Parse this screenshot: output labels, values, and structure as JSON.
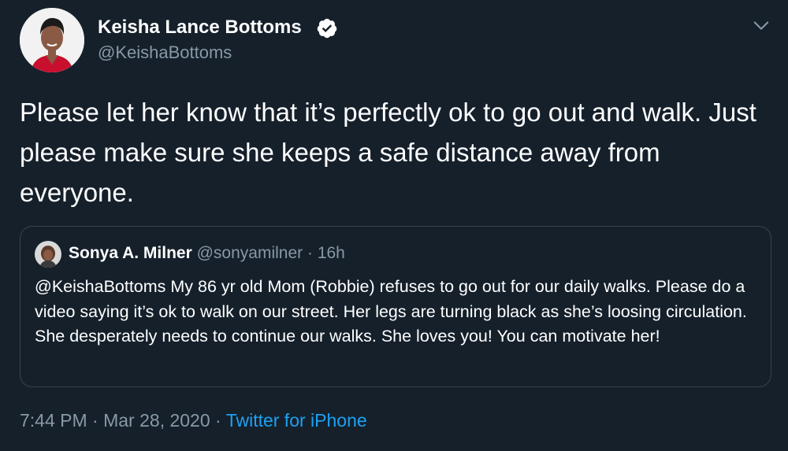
{
  "author": {
    "display_name": "Keisha Lance Bottoms",
    "handle": "@KeishaBottoms",
    "verified_icon": "verified-badge-icon",
    "avatar_icon": "profile-photo-avatar"
  },
  "tweet": {
    "text": "Please let her know that it’s perfectly ok to go out and walk. Just please make sure she keeps a safe distance away from everyone."
  },
  "quoted_tweet": {
    "display_name": "Sonya A. Milner",
    "handle": "@sonyamilner",
    "separator": "·",
    "time": "16h",
    "text": "@KeishaBottoms My 86 yr old Mom (Robbie) refuses to go out for our daily walks. Please do a video saying it’s ok to walk on our street. Her legs are turning black as she’s loosing circulation. She desperately needs to continue our walks. She loves you! You can motivate her!"
  },
  "meta": {
    "time": "7:44 PM",
    "separator1": "·",
    "date": "Mar 28, 2020",
    "separator2": "·",
    "source": "Twitter for iPhone"
  },
  "colors": {
    "background": "#15202b",
    "secondary_text": "#8899a6",
    "link": "#1da1f2",
    "border": "#38444d"
  },
  "icons": {
    "menu": "chevron-down-icon",
    "verified": "verified-badge-icon"
  }
}
